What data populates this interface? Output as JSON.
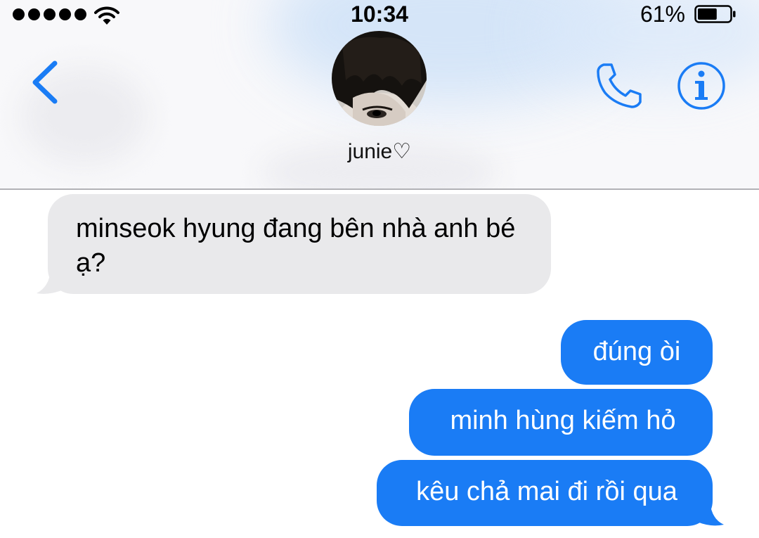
{
  "status_bar": {
    "signal_bars": 5,
    "time": "10:34",
    "battery_percent": "61%",
    "battery_level": 0.61,
    "wifi_icon": "wifi-icon"
  },
  "header": {
    "back_icon": "chevron-left-icon",
    "contact_name": "junie♡",
    "call_icon": "phone-icon",
    "info_icon": "info-icon"
  },
  "messages": [
    {
      "direction": "incoming",
      "text": "minseok hyung đang bên nhà anh bé ạ?"
    },
    {
      "direction": "outgoing",
      "text": "đúng òi"
    },
    {
      "direction": "outgoing",
      "text": "minh hùng kiếm hỏ"
    },
    {
      "direction": "outgoing",
      "text": "kêu chả mai đi rồi qua"
    }
  ],
  "colors": {
    "accent": "#1a7cf5",
    "incoming_bubble": "#e9e9eb",
    "outgoing_bubble": "#1a7cf5",
    "divider": "#b2b2b6"
  }
}
